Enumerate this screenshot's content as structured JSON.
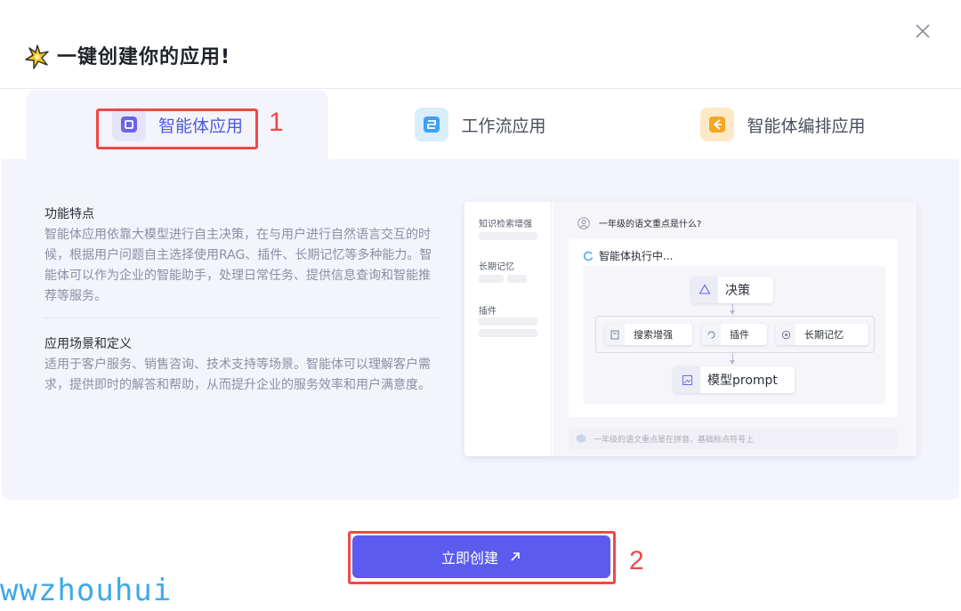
{
  "dialog": {
    "title": "一键创建你的应用!",
    "title_icon": "sparkle-icon"
  },
  "tabs": [
    {
      "label": "智能体应用",
      "icon": "agent-app-icon",
      "active": true,
      "icon_color": "#6b63e8"
    },
    {
      "label": "工作流应用",
      "icon": "workflow-app-icon",
      "active": false,
      "icon_color": "#3ba1f5"
    },
    {
      "label": "智能体编排应用",
      "icon": "orchestration-app-icon",
      "active": false,
      "icon_color": "#f5a623"
    }
  ],
  "annotations": {
    "tab_marker": "1",
    "button_marker": "2"
  },
  "features": {
    "title": "功能特点",
    "body": "智能体应用依靠大模型进行自主决策，在与用户进行自然语言交互的时候，根据用户问题自主选择使用RAG、插件、长期记忆等多种能力。智能体可以作为企业的智能助手，处理日常任务、提供信息查询和智能推荐等服务。"
  },
  "scenarios": {
    "title": "应用场景和定义",
    "body": "适用于客户服务、销售咨询、技术支持等场景。智能体可以理解客户需求，提供即时的解答和帮助，从而提升企业的服务效率和用户满意度。"
  },
  "preview": {
    "sidebar": [
      "知识检索增强",
      "长期记忆",
      "插件"
    ],
    "question": "一年级的语文重点是什么?",
    "executing": "智能体执行中...",
    "nodes": {
      "decision": "决策",
      "search": "搜索增强",
      "plugin": "插件",
      "memory": "长期记忆",
      "model": "模型prompt"
    },
    "answer": "一年级的语文重点是在拼音、基础标点符号上"
  },
  "actions": {
    "create_label": "立即创建"
  },
  "watermark": "wwzhouhui",
  "colors": {
    "accent": "#5b5bf0",
    "panel_bg": "#f4f4fc",
    "annotation": "#f04848"
  }
}
